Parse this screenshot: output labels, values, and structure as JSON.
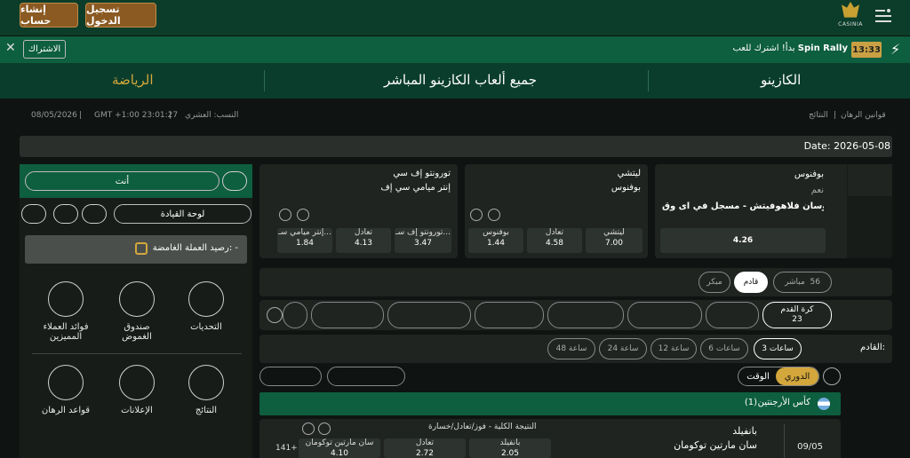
{
  "header": {
    "signup_label": "إنشاء حساب",
    "login_label": "تسجيل الدخول",
    "logo_text": "CASINIA"
  },
  "promo": {
    "subscribe_label": "الاشتراك",
    "timer": "13:33",
    "title": "Spin Rally",
    "text": "بدأ! اشترك للعب"
  },
  "nav": {
    "sports": "الرياضة",
    "live_casino": "جميع ألعاب الكازينو المباشر",
    "casino": "الكازينو"
  },
  "info": {
    "date": "08/05/2026",
    "time": "GMT +1:00 23:01:27",
    "odds_label": "النسب: العشري",
    "results": "النتائج",
    "rules": "قوانين الرهان"
  },
  "date_bar": "Date: 2026-05-08",
  "left": {
    "you": "أنت",
    "dashboard": "لوحة القيادة",
    "balance": "رصيد العملة الغامضة: -",
    "items": [
      {
        "label": "التحديات"
      },
      {
        "label": "صندوق الغموض"
      },
      {
        "label": "فوائد العملاء المميزين"
      },
      {
        "label": "النتائج"
      },
      {
        "label": "الإعلانات"
      },
      {
        "label": "قواعد الرهان"
      }
    ]
  },
  "cards": [
    {
      "team1": "تورونتو إف سي",
      "team2": "إنتر ميامي سي إف",
      "odds": [
        {
          "l": "تورونتو إف سـ...",
          "v": "3.47"
        },
        {
          "l": "تعادل",
          "v": "4.13"
        },
        {
          "l": "إنتر ميامي سـ...",
          "v": "1.84"
        }
      ]
    },
    {
      "team1": "ليتشي",
      "team2": "بوفنوس",
      "odds": [
        {
          "l": "ليتشي",
          "v": "7.00"
        },
        {
          "l": "تعادل",
          "v": "4.58"
        },
        {
          "l": "بوفنوس",
          "v": "1.44"
        }
      ]
    },
    {
      "team1": "بوفنوس",
      "team2": "نعم",
      "team3": "دوسان فلاهوفيتش - مسجل في اى وق...",
      "odds": [
        {
          "l": "",
          "v": "4.26"
        }
      ]
    }
  ],
  "filters": {
    "live": "مباشر",
    "live_count": "56",
    "upcoming": "قادم",
    "early": "مبكر",
    "football": "كرة القدم",
    "football_count": "23",
    "upcoming_label": "القادم:",
    "hours": [
      "3 ساعات",
      "6 ساعات",
      "12 ساعة",
      "24 ساعة",
      "48 ساعة"
    ],
    "league_tab": "الدوري",
    "time_tab": "الوقت"
  },
  "league": {
    "name": "كأس الأرجنتين",
    "count": "(1)"
  },
  "match": {
    "team1": "بانفيلد",
    "team2": "سان مارتين توكومان",
    "date": "09/05",
    "market": "النتيجة الكلية - فوز/تعادل/خسارة",
    "more": "141+",
    "odds": [
      {
        "l": "بانفيلد",
        "v": "2.05"
      },
      {
        "l": "تعادل",
        "v": "2.72"
      },
      {
        "l": "سان مارتين توكومان",
        "v": "4.10"
      }
    ]
  }
}
